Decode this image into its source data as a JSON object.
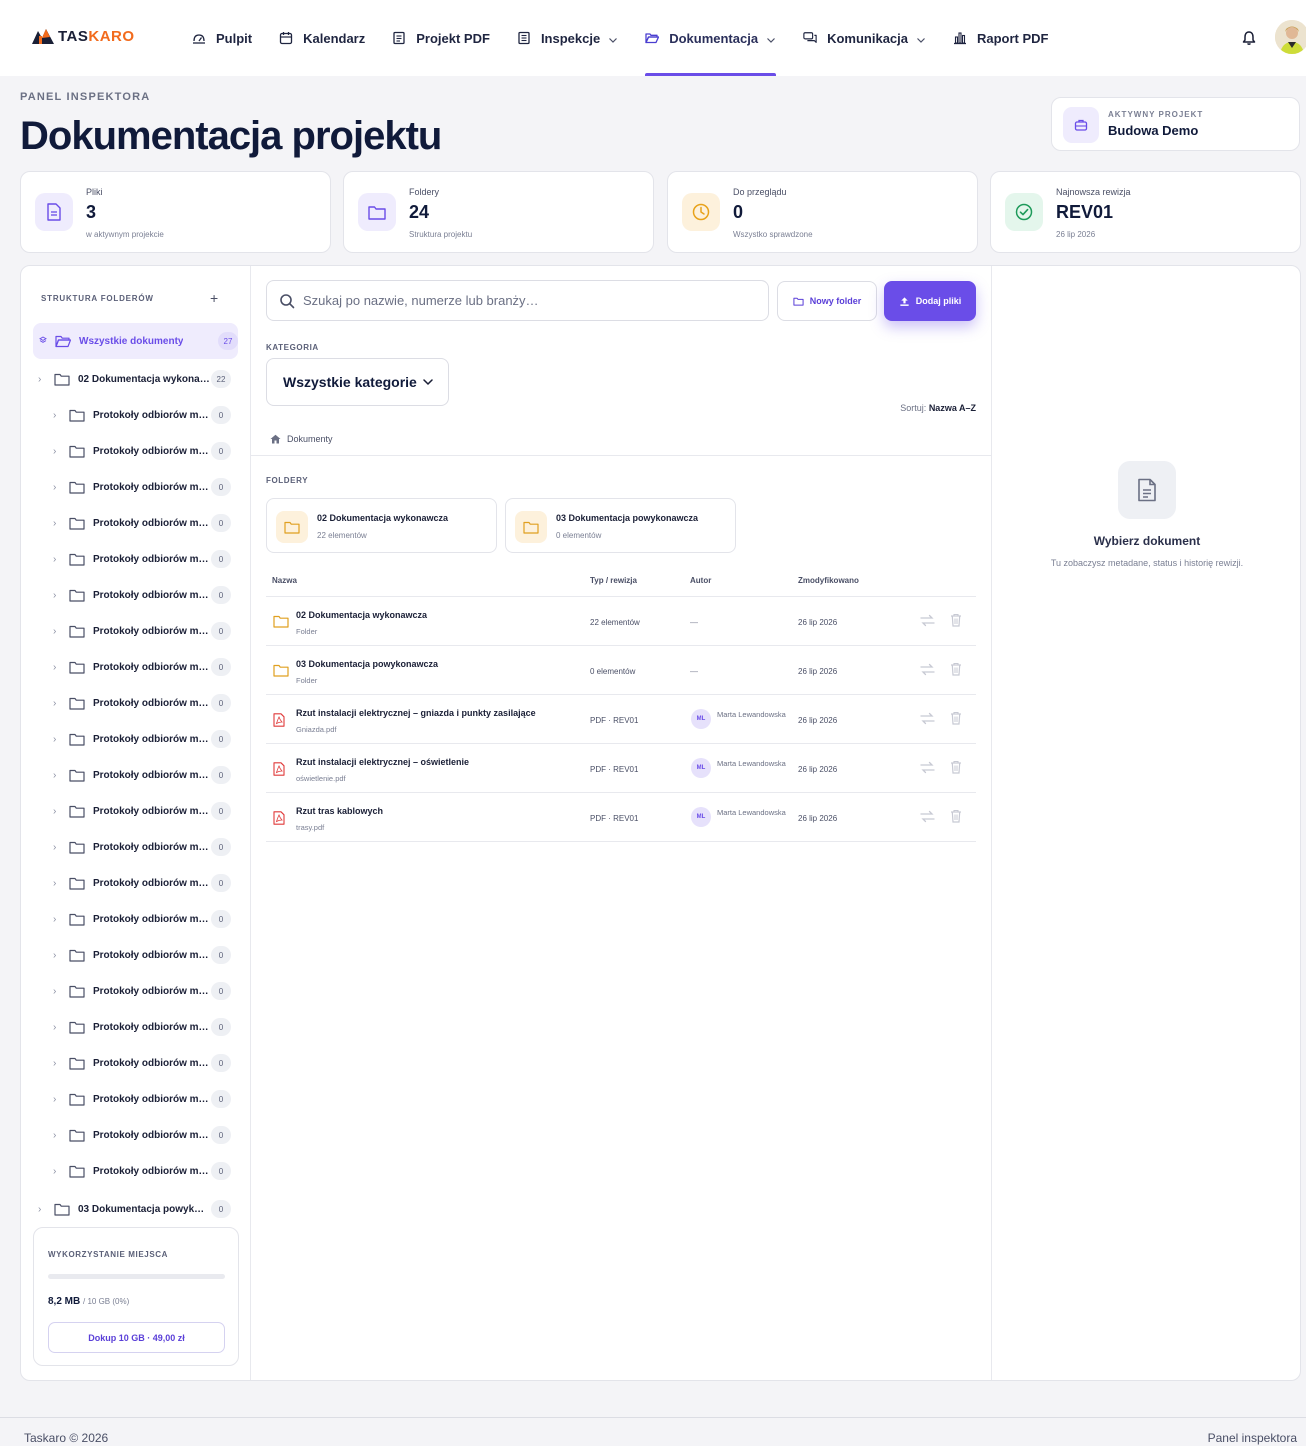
{
  "app": {
    "logo_part1": "TAS",
    "logo_part2": "KARO",
    "brand_color": "#6a4de8",
    "logo_accent": "#f26b1d"
  },
  "nav": {
    "items": [
      {
        "label": "Pulpit",
        "icon": "dashboard-icon",
        "has_menu": false,
        "active": false
      },
      {
        "label": "Kalendarz",
        "icon": "calendar-icon",
        "has_menu": false,
        "active": false
      },
      {
        "label": "Projekt PDF",
        "icon": "document-icon",
        "has_menu": false,
        "active": false
      },
      {
        "label": "Inspekcje",
        "icon": "clipboard-icon",
        "has_menu": true,
        "active": false
      },
      {
        "label": "Dokumentacja",
        "icon": "folder-open-icon",
        "has_menu": true,
        "active": true
      },
      {
        "label": "Komunikacja",
        "icon": "chat-icon",
        "has_menu": true,
        "active": false
      },
      {
        "label": "Raport PDF",
        "icon": "bar-chart-icon",
        "has_menu": false,
        "active": false
      }
    ]
  },
  "header": {
    "eyebrow": "PANEL INSPEKTORA",
    "title": "Dokumentacja projektu",
    "active_project_label": "AKTYWNY PROJEKT",
    "active_project_value": "Budowa Demo"
  },
  "stats": [
    {
      "label": "Pliki",
      "value": "3",
      "sub": "w aktywnym projekcie",
      "icon": "file-icon",
      "color": "#6a4de8",
      "bg": "#efecfd"
    },
    {
      "label": "Foldery",
      "value": "24",
      "sub": "Struktura projektu",
      "icon": "folder-icon",
      "color": "#6a4de8",
      "bg": "#efecfd"
    },
    {
      "label": "Do przeglądu",
      "value": "0",
      "sub": "Wszystko sprawdzone",
      "icon": "clock-icon",
      "color": "#e8a21a",
      "bg": "#fdf1dc"
    },
    {
      "label": "Najnowsza rewizja",
      "value": "REV01",
      "sub": "26 lip 2026",
      "icon": "check-circle-icon",
      "color": "#1e9a5a",
      "bg": "#e4f6ec"
    }
  ],
  "sidebar": {
    "title": "STRUKTURA FOLDERÓW",
    "add_label": "+",
    "tree": [
      {
        "label": "Wszystkie dokumenty",
        "count": "27",
        "level": 0,
        "selected": true,
        "chevron": false
      },
      {
        "label": "02 Dokumentacja wykona…",
        "count": "22",
        "level": 0,
        "selected": false,
        "chevron": true
      },
      {
        "label": "Protokoły odbiorów m…",
        "count": "0",
        "level": 1,
        "selected": false,
        "chevron": true
      },
      {
        "label": "Protokoły odbiorów m…",
        "count": "0",
        "level": 1,
        "selected": false,
        "chevron": true
      },
      {
        "label": "Protokoły odbiorów m…",
        "count": "0",
        "level": 1,
        "selected": false,
        "chevron": true
      },
      {
        "label": "Protokoły odbiorów m…",
        "count": "0",
        "level": 1,
        "selected": false,
        "chevron": true
      },
      {
        "label": "Protokoły odbiorów m…",
        "count": "0",
        "level": 1,
        "selected": false,
        "chevron": true
      },
      {
        "label": "Protokoły odbiorów m…",
        "count": "0",
        "level": 1,
        "selected": false,
        "chevron": true
      },
      {
        "label": "Protokoły odbiorów m…",
        "count": "0",
        "level": 1,
        "selected": false,
        "chevron": true
      },
      {
        "label": "Protokoły odbiorów m…",
        "count": "0",
        "level": 1,
        "selected": false,
        "chevron": true
      },
      {
        "label": "Protokoły odbiorów m…",
        "count": "0",
        "level": 1,
        "selected": false,
        "chevron": true
      },
      {
        "label": "Protokoły odbiorów m…",
        "count": "0",
        "level": 1,
        "selected": false,
        "chevron": true
      },
      {
        "label": "Protokoły odbiorów m…",
        "count": "0",
        "level": 1,
        "selected": false,
        "chevron": true
      },
      {
        "label": "Protokoły odbiorów m…",
        "count": "0",
        "level": 1,
        "selected": false,
        "chevron": true
      },
      {
        "label": "Protokoły odbiorów m…",
        "count": "0",
        "level": 1,
        "selected": false,
        "chevron": true
      },
      {
        "label": "Protokoły odbiorów m…",
        "count": "0",
        "level": 1,
        "selected": false,
        "chevron": true
      },
      {
        "label": "Protokoły odbiorów m…",
        "count": "0",
        "level": 1,
        "selected": false,
        "chevron": true
      },
      {
        "label": "Protokoły odbiorów m…",
        "count": "0",
        "level": 1,
        "selected": false,
        "chevron": true
      },
      {
        "label": "Protokoły odbiorów m…",
        "count": "0",
        "level": 1,
        "selected": false,
        "chevron": true
      },
      {
        "label": "Protokoły odbiorów m…",
        "count": "0",
        "level": 1,
        "selected": false,
        "chevron": true
      },
      {
        "label": "Protokoły odbiorów m…",
        "count": "0",
        "level": 1,
        "selected": false,
        "chevron": true
      },
      {
        "label": "Protokoły odbiorów m…",
        "count": "0",
        "level": 1,
        "selected": false,
        "chevron": true
      },
      {
        "label": "Protokoły odbiorów m…",
        "count": "0",
        "level": 1,
        "selected": false,
        "chevron": true
      },
      {
        "label": "Protokoły odbiorów m…",
        "count": "0",
        "level": 1,
        "selected": false,
        "chevron": true
      },
      {
        "label": "03 Dokumentacja powyk…",
        "count": "0",
        "level": 0,
        "selected": false,
        "chevron": true
      }
    ],
    "storage": {
      "title": "WYKORZYSTANIE MIEJSCA",
      "used": "8,2 MB",
      "total": "/ 10 GB (0%)",
      "percent": 0,
      "button": "Dokup 10 GB · 49,00 zł"
    }
  },
  "toolbar": {
    "search_placeholder": "Szukaj po nazwie, numerze lub branży…",
    "new_folder": "Nowy folder",
    "add_files": "Dodaj pliki"
  },
  "filters": {
    "category_label": "KATEGORIA",
    "category_value": "Wszystkie kategorie",
    "sort_label": "Sortuj:",
    "sort_value": "Nazwa A–Z"
  },
  "breadcrumb": {
    "root": "Dokumenty"
  },
  "folders": {
    "label": "FOLDERY",
    "cards": [
      {
        "name": "02 Dokumentacja wykonawcza",
        "sub": "22 elementów"
      },
      {
        "name": "03 Dokumentacja powykonawcza",
        "sub": "0 elementów"
      }
    ]
  },
  "table": {
    "headers": {
      "name": "Nazwa",
      "type": "Typ / rewizja",
      "author": "Autor",
      "modified": "Zmodyfikowano"
    },
    "rows": [
      {
        "kind": "folder",
        "name": "02 Dokumentacja wykonawcza",
        "sub": "Folder",
        "type": "22 elementów",
        "author": "—",
        "initials": "",
        "modified": "26 lip 2026"
      },
      {
        "kind": "folder",
        "name": "03 Dokumentacja powykonawcza",
        "sub": "Folder",
        "type": "0 elementów",
        "author": "—",
        "initials": "",
        "modified": "26 lip 2026"
      },
      {
        "kind": "pdf",
        "name": "Rzut instalacji elektrycznej – gniazda i punkty zasilające",
        "sub": "Gniazda.pdf",
        "type": "PDF · REV01",
        "author": "Marta Lewandowska",
        "initials": "ML",
        "modified": "26 lip 2026"
      },
      {
        "kind": "pdf",
        "name": "Rzut instalacji elektrycznej – oświetlenie",
        "sub": "oświetlenie.pdf",
        "type": "PDF · REV01",
        "author": "Marta Lewandowska",
        "initials": "ML",
        "modified": "26 lip 2026"
      },
      {
        "kind": "pdf",
        "name": "Rzut tras kablowych",
        "sub": "trasy.pdf",
        "type": "PDF · REV01",
        "author": "Marta Lewandowska",
        "initials": "ML",
        "modified": "26 lip 2026"
      }
    ]
  },
  "details": {
    "title": "Wybierz dokument",
    "sub": "Tu zobaczysz metadane, status i historię rewizji."
  },
  "footer": {
    "left": "Taskaro © 2026",
    "right": "Panel inspektora"
  }
}
